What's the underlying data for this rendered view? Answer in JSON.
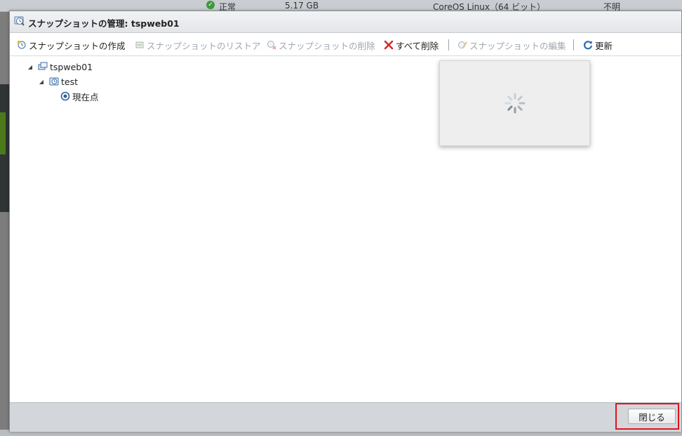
{
  "background": {
    "status": "正常",
    "size": "5.17 GB",
    "os": "CoreOS Linux（64 ビット）",
    "state": "不明"
  },
  "dialog": {
    "title": "スナップショットの管理: tspweb01"
  },
  "toolbar": {
    "create": "スナップショットの作成",
    "restore": "スナップショットのリストア",
    "delete": "スナップショットの削除",
    "delete_all": "すべて削除",
    "edit": "スナップショットの編集",
    "refresh": "更新"
  },
  "tree": {
    "vm": "tspweb01",
    "snapshot": "test",
    "current": "現在点"
  },
  "footer": {
    "close": "閉じる"
  },
  "colors": {
    "highlight": "#e0161c",
    "delete_all_icon": "#d22b2b",
    "refresh_icon": "#2a6db3"
  }
}
